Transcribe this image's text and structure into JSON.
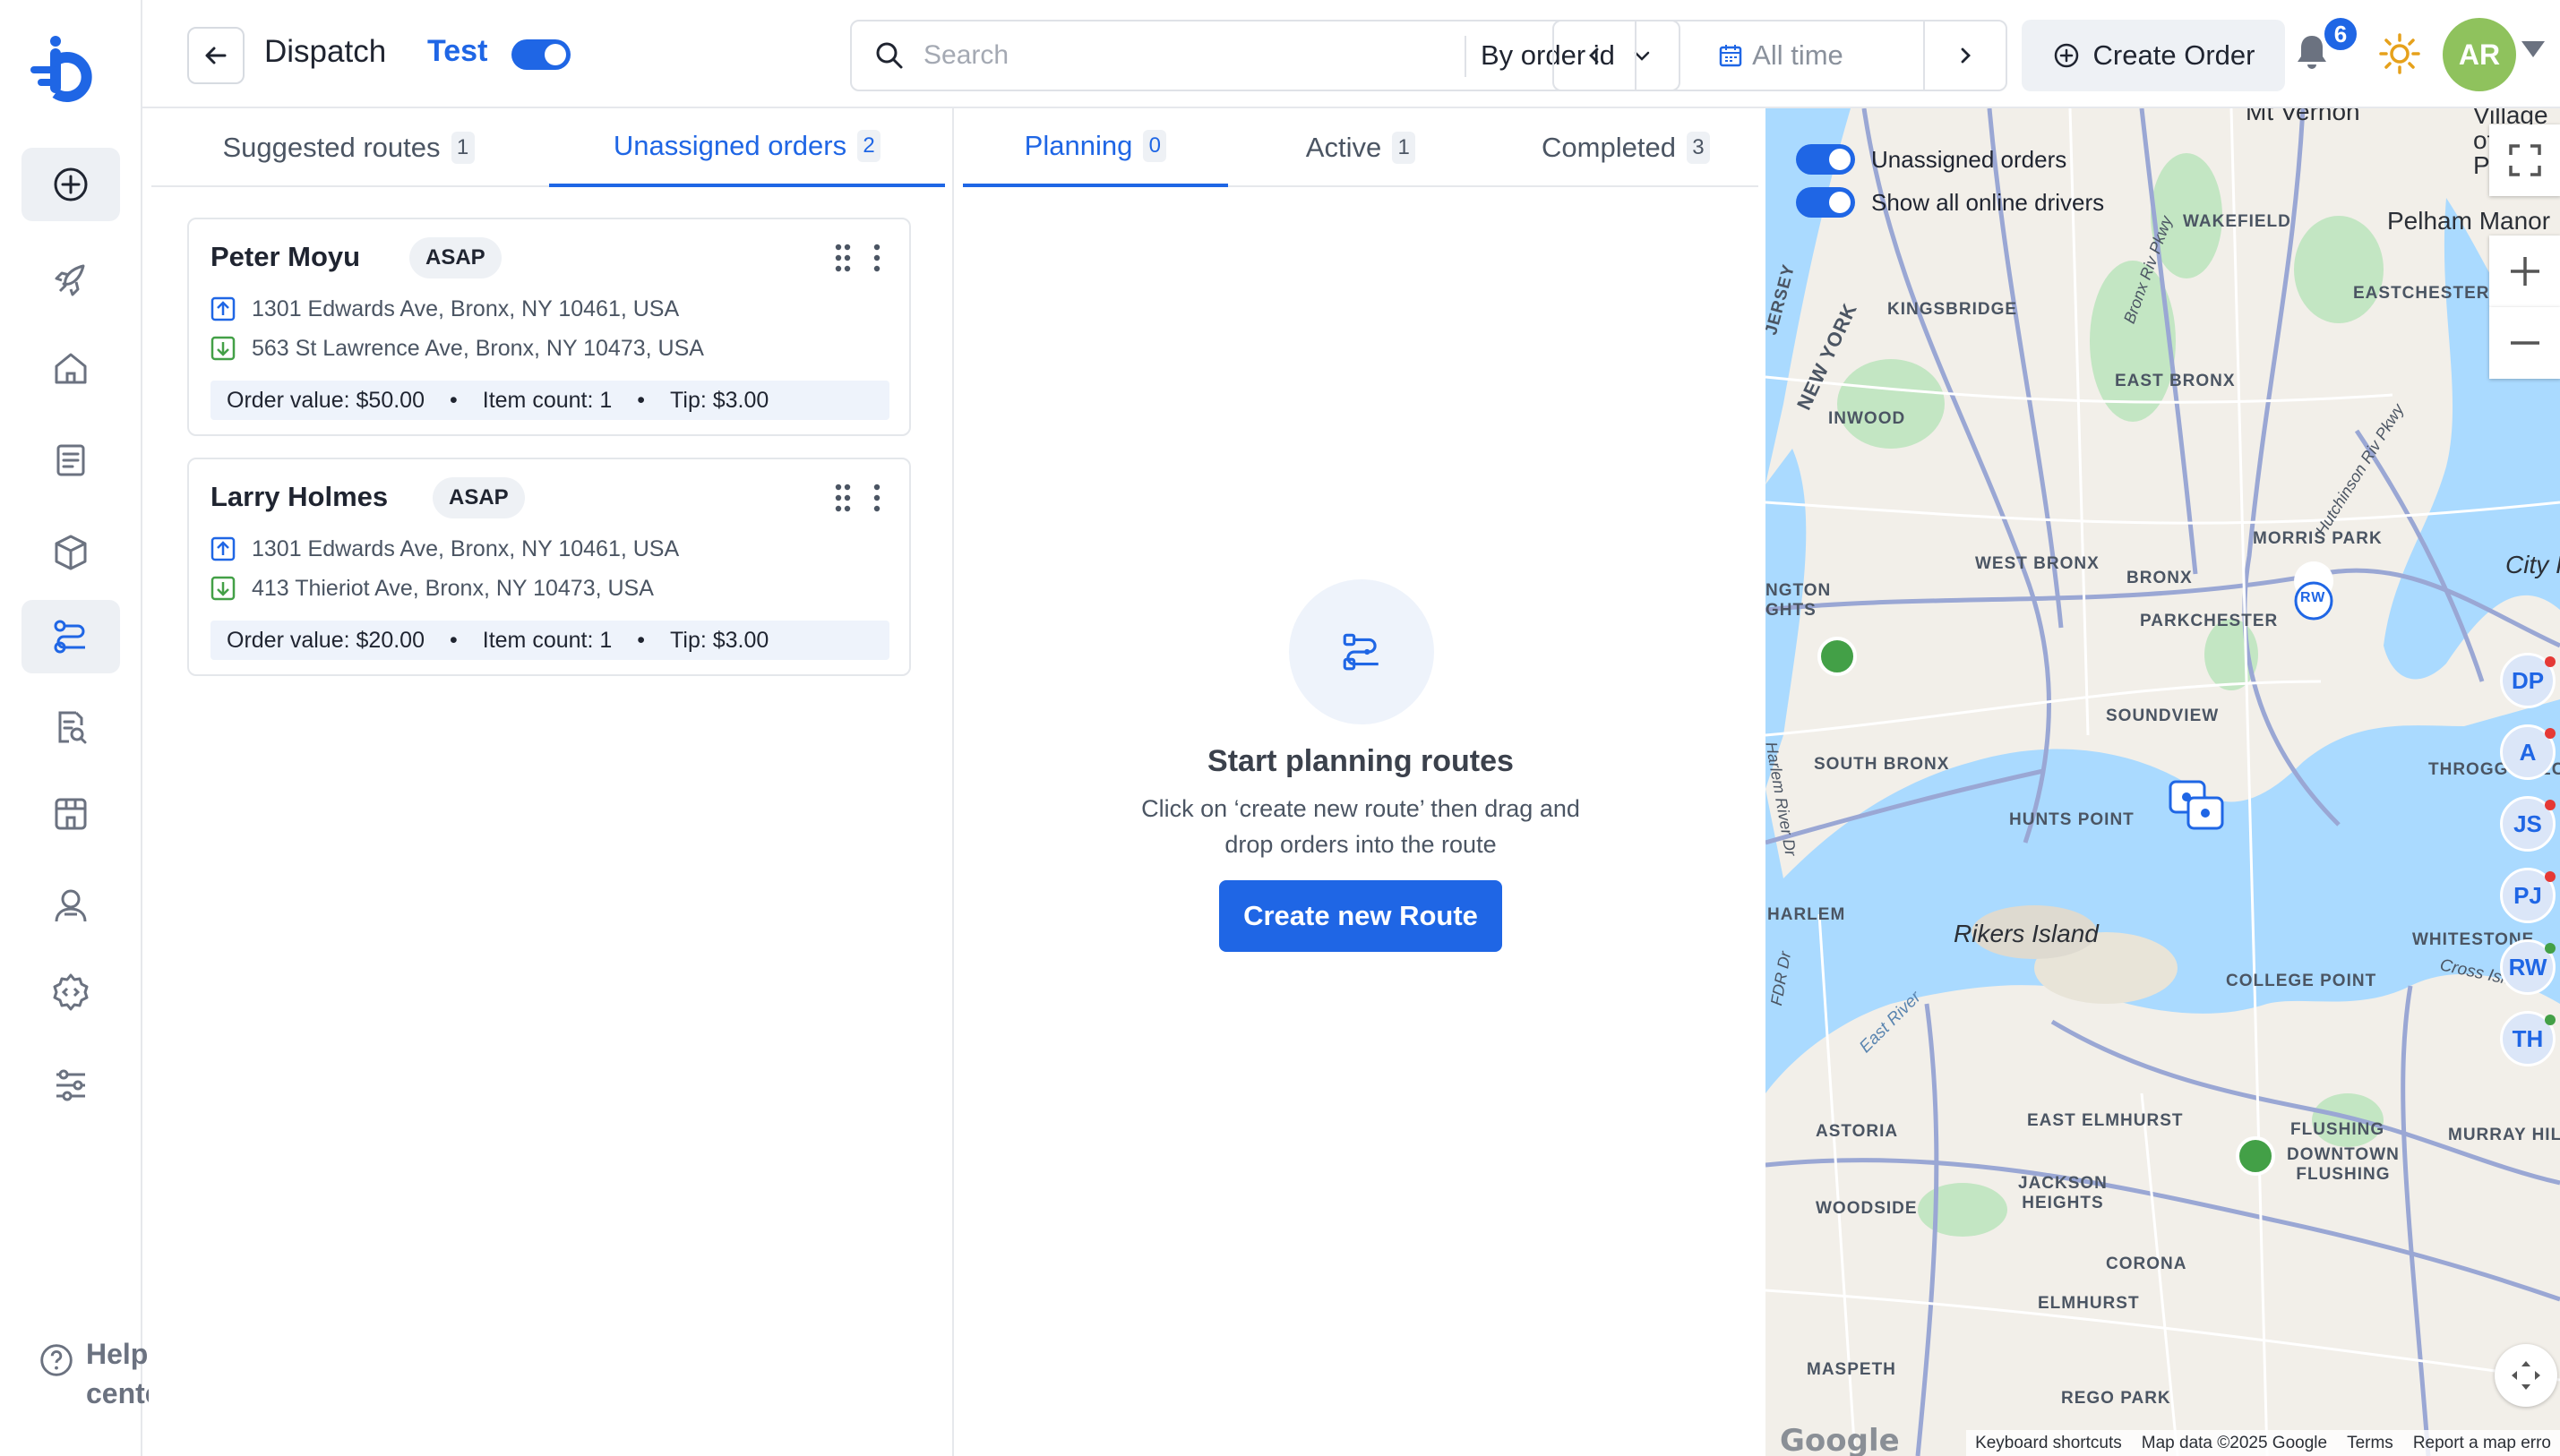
{
  "sidebar": {
    "help_label": "Help center"
  },
  "header": {
    "title": "Dispatch",
    "test_label": "Test",
    "test_mode_on": true,
    "search_placeholder": "Search",
    "search_mode": "By order id",
    "date_range": "All time",
    "create_order_label": "Create Order",
    "notification_count": "6",
    "avatar_initials": "AR"
  },
  "left_tabs": [
    {
      "label": "Suggested routes",
      "count": "1",
      "active": false
    },
    {
      "label": "Unassigned orders",
      "count": "2",
      "active": true
    }
  ],
  "orders": [
    {
      "name": "Peter Moyu",
      "tag": "ASAP",
      "pickup": "1301 Edwards Ave, Bronx, NY 10461, USA",
      "dropoff": "563 St Lawrence Ave, Bronx, NY 10473, USA",
      "order_value": "Order value: $50.00",
      "item_count": "Item count: 1",
      "tip": "Tip: $3.00"
    },
    {
      "name": "Larry Holmes",
      "tag": "ASAP",
      "pickup": "1301 Edwards Ave, Bronx, NY 10461, USA",
      "dropoff": "413 Thieriot Ave, Bronx, NY 10473, USA",
      "order_value": "Order value: $20.00",
      "item_count": "Item count: 1",
      "tip": "Tip: $3.00"
    }
  ],
  "route_tabs": [
    {
      "label": "Planning",
      "count": "0",
      "active": true
    },
    {
      "label": "Active",
      "count": "1",
      "active": false
    },
    {
      "label": "Completed",
      "count": "3",
      "active": false
    }
  ],
  "empty_state": {
    "title": "Start planning routes",
    "description": "Click on ‘create new route’ then drag and drop orders into the route",
    "button_label": "Create new Route"
  },
  "map": {
    "toggles": [
      {
        "label": "Unassigned orders",
        "on": true
      },
      {
        "label": "Show all online drivers",
        "on": true
      }
    ],
    "drivers": [
      {
        "initials": "DP",
        "status_color": "#e53935"
      },
      {
        "initials": "A",
        "status_color": "#e53935"
      },
      {
        "initials": "JS",
        "status_color": "#e53935"
      },
      {
        "initials": "PJ",
        "status_color": "#e53935"
      },
      {
        "initials": "RW",
        "status_color": "#43a047"
      },
      {
        "initials": "TH",
        "status_color": "#43a047"
      }
    ],
    "pin_label": "RW",
    "labels": {
      "mt_vernon": "Mt Vernon",
      "village_of_pelham": "Village of Pelham",
      "pelham_manor": "Pelham Manor",
      "wakefield": "WAKEFIELD",
      "eastchester": "EASTCHESTER",
      "kingsbridge": "KINGSBRIDGE",
      "jersey": "JERSEY",
      "new_york": "NEW YORK",
      "east_bronx": "EAST BRONX",
      "inwood": "INWOOD",
      "morris_park": "MORRIS PARK",
      "west_bronx": "WEST BRONX",
      "bronx": "BRONX",
      "parkchester": "PARKCHESTER",
      "city_island": "City I",
      "ngton_hts": "NGTON\nGHTS",
      "soundview": "SOUNDVIEW",
      "south_bronx": "SOUTH BRONX",
      "throggs_neck": "THROGGS NEC",
      "hunts_point": "HUNTS POINT",
      "harlem": "HARLEM",
      "rikers_island": "Rikers Island",
      "whitestone": "WHITESTONE",
      "college_point": "COLLEGE POINT",
      "cross_island": "Cross Islan",
      "east_river": "East River",
      "harlem_river_dr": "Harlem River Dr",
      "fdr_dr": "FDR Dr",
      "bronx_riv_pkwy": "Bronx Riv Pkwy",
      "hutchinson_pkwy": "Hutchinson Riv Pkwy",
      "astoria": "ASTORIA",
      "east_elmhurst": "EAST ELMHURST",
      "flushing": "FLUSHING",
      "murray_hill": "MURRAY HILL",
      "downtown_flushing": "DOWNTOWN\nFLUSHING",
      "jackson_heights": "JACKSON\nHEIGHTS",
      "woodside": "WOODSIDE",
      "corona": "CORONA",
      "elmhurst": "ELMHURST",
      "maspeth": "MASPETH",
      "rego_park": "REGO PARK"
    },
    "footer": {
      "google": "Google",
      "shortcuts": "Keyboard shortcuts",
      "map_data": "Map data ©2025 Google",
      "terms": "Terms",
      "report": "Report a map erro"
    }
  }
}
